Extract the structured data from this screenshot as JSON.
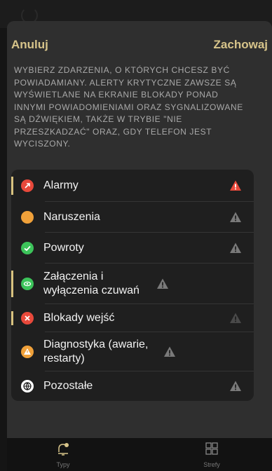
{
  "header": {
    "cancel_label": "Anuluj",
    "save_label": "Zachowaj"
  },
  "info_text": "WYBIERZ ZDARZENIA, O KTÓRYCH CHCESZ BYĆ POWIADAMIANY. ALERTY KRYTYCZNE ZAWSZE SĄ WYŚWIETLANE NA EKRANIE BLOKADY PONAD INNYMI POWIADOMIENIAMI ORAZ SYGNALIZOWANE SĄ DŹWIĘKIEM, TAKŻE W TRYBIE \"NIE PRZESZKADZAĆ\" ORAZ, GDY TELEFON JEST WYCISZONY.",
  "events": [
    {
      "label": "Alarmy",
      "icon": "rocket-icon",
      "color": "#e8493b",
      "selected": true,
      "critical": true
    },
    {
      "label": "Naruszenia",
      "icon": "dot-icon",
      "color": "#f0a13a",
      "selected": false,
      "critical": false
    },
    {
      "label": "Powroty",
      "icon": "check-icon",
      "color": "#3cc35a",
      "selected": false,
      "critical": false
    },
    {
      "label": "Załączenia i wyłączenia czuwań",
      "icon": "eye-icon",
      "color": "#3cc35a",
      "selected": true,
      "critical": false
    },
    {
      "label": "Blokady wejść",
      "icon": "x-icon",
      "color": "#e8493b",
      "selected": true,
      "critical": false
    },
    {
      "label": "Diagnostyka (awarie, restarty)",
      "icon": "warning-icon",
      "color": "#f0a13a",
      "selected": false,
      "critical": false
    },
    {
      "label": "Pozostałe",
      "icon": "globe-icon",
      "color": "#ffffff",
      "selected": false,
      "critical": false
    }
  ],
  "tabs": [
    {
      "label": "Typy",
      "icon": "bell-icon",
      "active": true
    },
    {
      "label": "Strefy",
      "icon": "grid-icon",
      "active": false
    }
  ],
  "colors": {
    "accent": "#d7c48a",
    "critical": "#e8493b",
    "muted": "#7a7a7a"
  }
}
